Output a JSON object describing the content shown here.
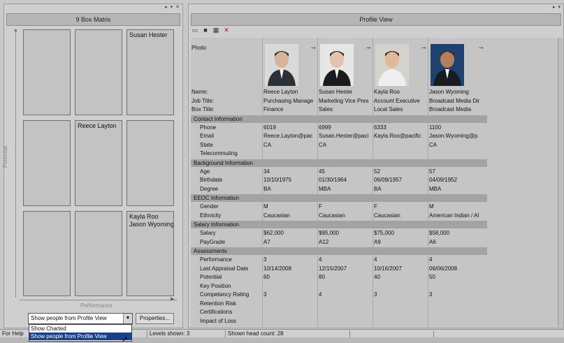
{
  "left_pane": {
    "title": "9 Box Matrix",
    "controls": "▸ ▾ ✕",
    "axis_y_label": "Potential",
    "axis_x_label": "Performance",
    "boxes": [
      {
        "names": ""
      },
      {
        "names": ""
      },
      {
        "names": "Susan Hester"
      },
      {
        "names": ""
      },
      {
        "names": "Reece Layton"
      },
      {
        "names": ""
      },
      {
        "names": ""
      },
      {
        "names": ""
      },
      {
        "names": "Kayla Roo\nJason Wyoming"
      }
    ],
    "dropdown_value": "Show people from Profile View",
    "dropdown_options": [
      "Show Charted",
      "Show people from Profile View"
    ],
    "properties_button": "Properties..."
  },
  "right_pane": {
    "title": "Profile View",
    "controls": "▸ ▾",
    "toolbar_icons": [
      "card-view-icon",
      "save-icon",
      "grid-icon",
      "pin-icon"
    ],
    "header_labels": {
      "photo": "Photo",
      "name": "Name:",
      "job_title": "Job Title:",
      "box_title": "Box Title:"
    },
    "people": [
      {
        "name": "Reece Layton",
        "job_title": "Purchasing Manage",
        "box_title": "Finance",
        "phone": "6019",
        "email": "Reece.Layton@pac",
        "state": "CA",
        "telecommuting": "",
        "age": "34",
        "birthdate": "10/10/1975",
        "degree": "BA",
        "gender": "M",
        "ethnicity": "Caucasian",
        "salary": "$62,000",
        "paygrade": "A7",
        "performance": "3",
        "last_appraisal": "10/14/2008",
        "potential": "60",
        "key_position": "",
        "competancy": "3",
        "retention": "",
        "certifications": "",
        "impact": "",
        "bg": "#d9d9d9",
        "skin": "#d7b39b",
        "suit": "#2b2f37"
      },
      {
        "name": "Susan Hester",
        "job_title": "Marketing Vice Pres",
        "box_title": "Sales",
        "phone": "6999",
        "email": "Susan.Hester@paci",
        "state": "CA",
        "telecommuting": "",
        "age": "45",
        "birthdate": "01/30/1964",
        "degree": "MBA",
        "gender": "F",
        "ethnicity": "Caucasian",
        "salary": "$95,000",
        "paygrade": "A12",
        "performance": "4",
        "last_appraisal": "12/15/2007",
        "potential": "80",
        "key_position": "",
        "competancy": "4",
        "retention": "",
        "certifications": "",
        "impact": "",
        "bg": "#e6e6e6",
        "skin": "#e3c2ad",
        "suit": "#1b1b1b"
      },
      {
        "name": "Kayla Roo",
        "job_title": "Account Executive",
        "box_title": "Local Sales",
        "phone": "6333",
        "email": "Kayla.Roo@pacific",
        "state": "",
        "telecommuting": "",
        "age": "52",
        "birthdate": "06/09/1957",
        "degree": "BA",
        "gender": "F",
        "ethnicity": "Caucasian",
        "salary": "$75,000",
        "paygrade": "A9",
        "performance": "4",
        "last_appraisal": "10/16/2007",
        "potential": "40",
        "key_position": "",
        "competancy": "3",
        "retention": "",
        "certifications": "",
        "impact": "",
        "bg": "#d5d1cc",
        "skin": "#e1b896",
        "suit": "#eeeeee"
      },
      {
        "name": "Jason Wyoming",
        "job_title": "Broadcast Media Dir",
        "box_title": "Broadcast Media",
        "phone": "1100",
        "email": "Jason.Wyoming@p",
        "state": "CA",
        "telecommuting": "",
        "age": "57",
        "birthdate": "04/09/1952",
        "degree": "MBA",
        "gender": "M",
        "ethnicity": "American Indian / Al",
        "salary": "$58,000",
        "paygrade": "A6",
        "performance": "4",
        "last_appraisal": "06/06/2008",
        "potential": "50",
        "key_position": "",
        "competancy": "3",
        "retention": "",
        "certifications": "",
        "impact": "",
        "bg": "#1f4270",
        "skin": "#b57f5d",
        "suit": "#1b1b22"
      }
    ],
    "sections": {
      "contact": {
        "title": "Contact Information",
        "labels": [
          "Phone",
          "Email",
          "State",
          "Telecommuting"
        ]
      },
      "background": {
        "title": "Background Information",
        "labels": [
          "Age",
          "Birthdate",
          "Degree"
        ]
      },
      "eeoc": {
        "title": "EEOC Information",
        "labels": [
          "Gender",
          "Ethnicity"
        ]
      },
      "salary": {
        "title": "Salary Information",
        "labels": [
          "Salary",
          "PayGrade"
        ]
      },
      "assessments": {
        "title": "Assessments",
        "labels": [
          "Performance",
          "Last Appraisal Date",
          "Potential",
          "Key Position",
          "Competancy Rating",
          "Retention Risk",
          "Certifications",
          "Impact of Loss"
        ]
      }
    }
  },
  "status_bar": {
    "help": "For Help",
    "levels": "Levels shown: 3",
    "headcount": "Shown head count: 28"
  }
}
